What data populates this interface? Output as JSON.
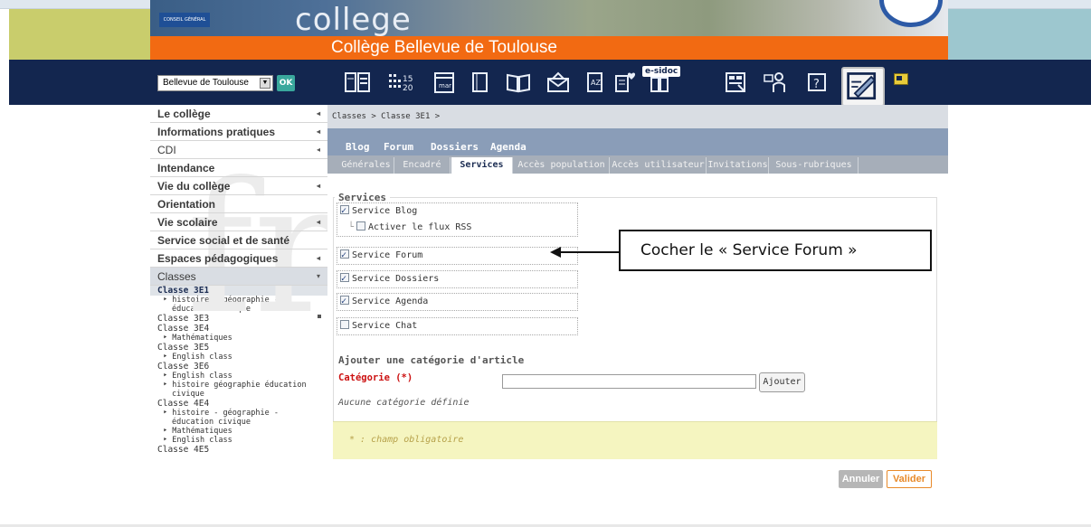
{
  "header": {
    "site_title": "Collège Bellevue de Toulouse",
    "banner_word": "college",
    "conseil_logo_text": "CONSEIL GÉNÉRAL"
  },
  "toolbar": {
    "site_select_value": "Bellevue de Toulouse",
    "ok_label": "OK",
    "sidoc_label": "e-sidoc",
    "icons": [
      "calendar-grid-icon",
      "stats-icon",
      "agenda-icon",
      "book-icon",
      "open-book-icon",
      "envelope-icon",
      "directory-icon",
      "document-favorite-icon",
      "library-sidoc-icon",
      "forms-icon",
      "users-icon",
      "help-icon",
      "edit-mode-icon",
      "window-icon"
    ]
  },
  "sidebar": {
    "items": [
      {
        "label": "Le collège",
        "caret": "◂"
      },
      {
        "label": "Informations pratiques",
        "caret": "◂"
      },
      {
        "label": "CDI",
        "caret": "◂"
      },
      {
        "label": "Intendance",
        "caret": ""
      },
      {
        "label": "Vie du collège",
        "caret": "◂"
      },
      {
        "label": "Orientation",
        "caret": ""
      },
      {
        "label": "Vie scolaire",
        "caret": "◂"
      },
      {
        "label": "Service social et de santé",
        "caret": ""
      },
      {
        "label": "Espaces pédagogiques",
        "caret": "◂"
      }
    ],
    "classes_label": "Classes",
    "classes_caret": "▾",
    "classes": [
      {
        "name": "Classe 3E1",
        "subs": [
          [
            "histoire - géographie -",
            "éducation civique"
          ]
        ]
      },
      {
        "name": "Classe 3E3",
        "subs": []
      },
      {
        "name": "Classe 3E4",
        "subs": [
          [
            "Mathématiques"
          ]
        ]
      },
      {
        "name": "Classe 3E5",
        "subs": [
          [
            "English class"
          ]
        ]
      },
      {
        "name": "Classe 3E6",
        "subs": [
          [
            "English class"
          ],
          [
            "histoire géographie éducation",
            "civique"
          ]
        ]
      },
      {
        "name": "Classe 4E4",
        "subs": [
          [
            "histoire - géographie -",
            "éducation civique"
          ],
          [
            "Mathématiques"
          ],
          [
            "English class"
          ]
        ]
      }
    ],
    "cut_item": "Classe 4E5"
  },
  "main": {
    "breadcrumb": "Classes > Classe 3E1 >",
    "top_tabs": [
      "Blog",
      "Forum",
      "Dossiers",
      "Agenda"
    ],
    "sub_tabs": [
      "Générales",
      "Encadré",
      "Services",
      "Accès population",
      "Accès utilisateur",
      "Invitations",
      "Sous-rubriques"
    ],
    "active_sub_tab": "Services",
    "services_legend": "Services",
    "services": {
      "blog": {
        "label": "Service Blog",
        "checked": true
      },
      "rss": {
        "label": "Activer le flux RSS",
        "checked": false
      },
      "forum": {
        "label": "Service Forum",
        "checked": true
      },
      "dossiers": {
        "label": "Service Dossiers",
        "checked": true
      },
      "agenda": {
        "label": "Service Agenda",
        "checked": true
      },
      "chat": {
        "label": "Service Chat",
        "checked": false
      }
    },
    "category": {
      "heading": "Ajouter une catégorie d'article",
      "label": "Catégorie (*)",
      "input_value": "",
      "add_label": "Ajouter",
      "empty_text": "Aucune catégorie définie"
    },
    "required_note": "* : champ obligatoire",
    "cancel_label": "Annuler",
    "validate_label": "Valider"
  },
  "annotation": {
    "text": "Cocher le « Service Forum »"
  },
  "colors": {
    "title_bar": "#f26a12",
    "navy": "#13264f",
    "tabs": "#8a9db8",
    "validate": "#e88a2a"
  }
}
